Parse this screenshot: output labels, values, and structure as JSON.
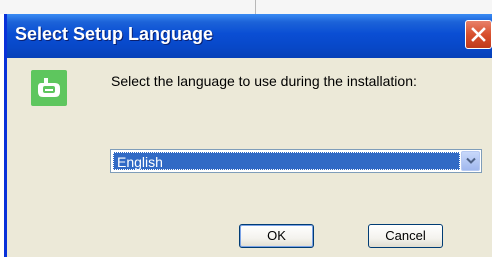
{
  "window": {
    "title": "Select Setup Language",
    "close_icon": "close-x-icon",
    "app_icon": "setup-app-icon"
  },
  "prompt": {
    "text": "Select the language to use during the installation:"
  },
  "language_select": {
    "selected": "English",
    "arrow_icon": "chevron-down-icon"
  },
  "buttons": {
    "ok_label": "OK",
    "cancel_label": "Cancel"
  },
  "colors": {
    "titlebar": "#0a4ed4",
    "close_button": "#d8502e",
    "selection": "#316ac5",
    "app_icon_bg": "#5ec65e",
    "dialog_bg": "#ece9d8"
  }
}
